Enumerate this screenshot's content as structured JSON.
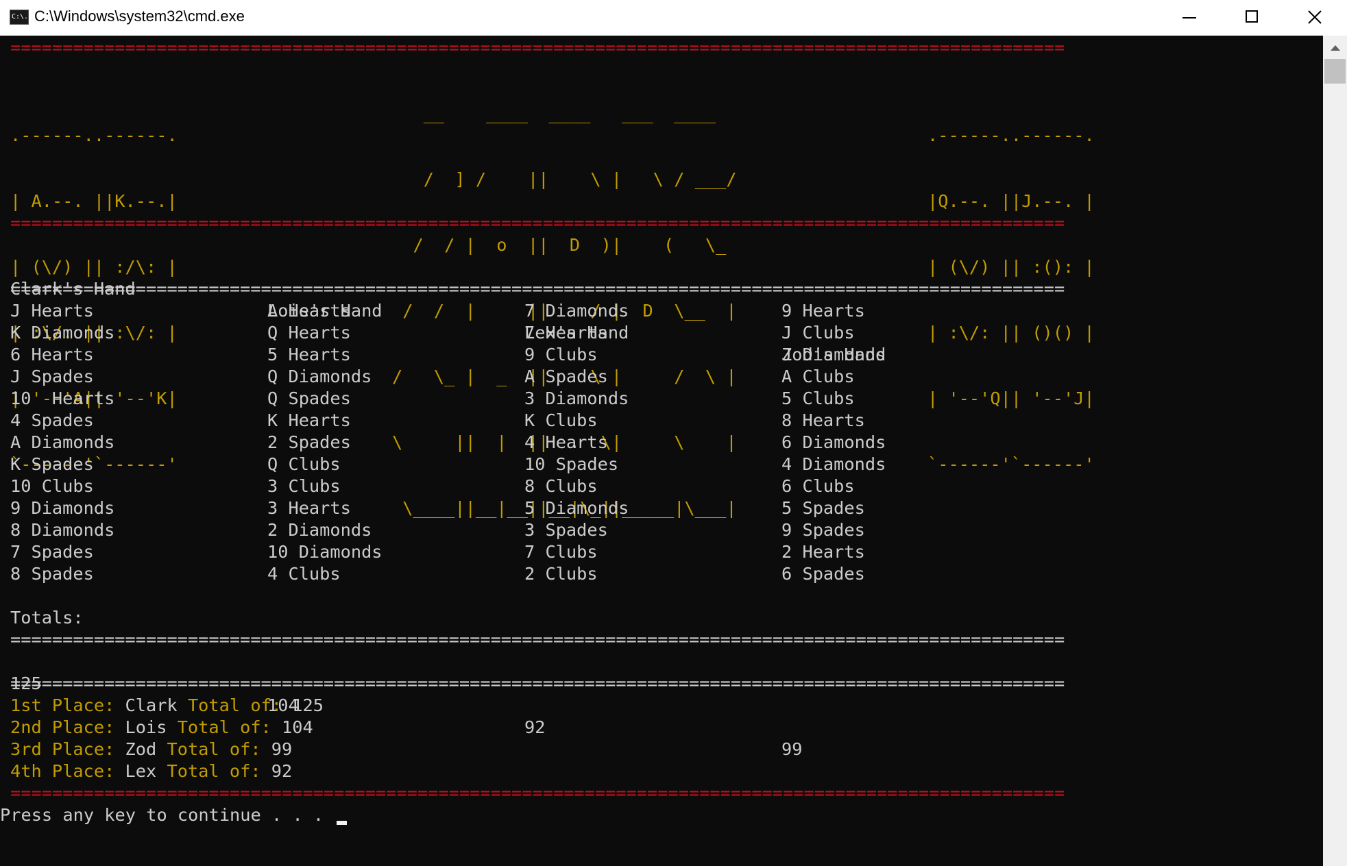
{
  "window": {
    "icon_text": "C:\\.",
    "title": "C:\\Windows\\system32\\cmd.exe"
  },
  "separator": "=====================================================================================================",
  "banner": {
    "left_cards": [
      ".------..------.",
      "| A.--. ||K.--.|",
      "| (\\/) || :/\\: |",
      "| :\\/: || :\\/: |",
      "| '--'A|| '--'K|",
      "`------'`------'"
    ],
    "logo": [
      "   __    ____  ____   ___  ____ ",
      "   /  ] /    ||    \\ |   \\ / ___/",
      "  /  / |  o  ||  D  )|    (   \\_ ",
      " /  /  |     ||    / |  D  \\__  |",
      "/   \\_ |  _  ||    \\ |     /  \\ |",
      "\\     ||  |  ||  .  \\|     \\    |",
      " \\____||__|__||__|\\_||_____|\\___|"
    ],
    "right_cards": [
      ".------..------.",
      "|Q.--. ||J.--. |",
      "| (\\/) || :(): |",
      "| :\\/: || ()() |",
      "| '--'Q|| '--'J|",
      "`------'`------'"
    ]
  },
  "hands": {
    "headers": [
      "Clark's Hand",
      "Lois's Hand",
      "Lex's Hand",
      "Zod's Hand"
    ],
    "rows": [
      [
        "J Hearts",
        "A Hearts",
        "7 Diamonds",
        "9 Hearts"
      ],
      [
        "K Diamonds",
        "Q Hearts",
        "7 Hearts",
        "J Clubs"
      ],
      [
        "6 Hearts",
        "5 Hearts",
        "9 Clubs",
        "J Diamonds"
      ],
      [
        "J Spades",
        "Q Diamonds",
        "A Spades",
        "A Clubs"
      ],
      [
        "10  Hearts",
        "Q Spades",
        "3 Diamonds",
        "5 Clubs"
      ],
      [
        "4 Spades",
        "K Hearts",
        "K Clubs",
        "8 Hearts"
      ],
      [
        "A Diamonds",
        "2 Spades",
        "4 Hearts",
        "6 Diamonds"
      ],
      [
        "K Spades",
        "Q Clubs",
        "10 Spades",
        "4 Diamonds"
      ],
      [
        "10 Clubs",
        "3 Clubs",
        "8 Clubs",
        "6 Clubs"
      ],
      [
        "9 Diamonds",
        "3 Hearts",
        "5 Diamonds",
        "5 Spades"
      ],
      [
        "8 Diamonds",
        "2 Diamonds",
        "3 Spades",
        "9 Spades"
      ],
      [
        "7 Spades",
        "10 Diamonds",
        "7 Clubs",
        "2 Hearts"
      ],
      [
        "8 Spades",
        "4 Clubs",
        "2 Clubs",
        "6 Spades"
      ]
    ]
  },
  "totals": {
    "label": "Totals:",
    "values": [
      "125",
      "104",
      "92",
      "99"
    ]
  },
  "places": [
    {
      "place": "1st Place:",
      "name": "Clark",
      "total_label": "Total of:",
      "total": "125"
    },
    {
      "place": "2nd Place:",
      "name": "Lois",
      "total_label": "Total of:",
      "total": "104"
    },
    {
      "place": "3rd Place:",
      "name": "Zod",
      "total_label": "Total of:",
      "total": "99"
    },
    {
      "place": "4th Place:",
      "name": "Lex",
      "total_label": "Total of:",
      "total": "92"
    }
  ],
  "prompt": "Press any key to continue . . . ",
  "colors": {
    "background": "#0c0c0c",
    "text": "#cccccc",
    "separator": "#c50f1f",
    "accent": "#c19c00"
  }
}
